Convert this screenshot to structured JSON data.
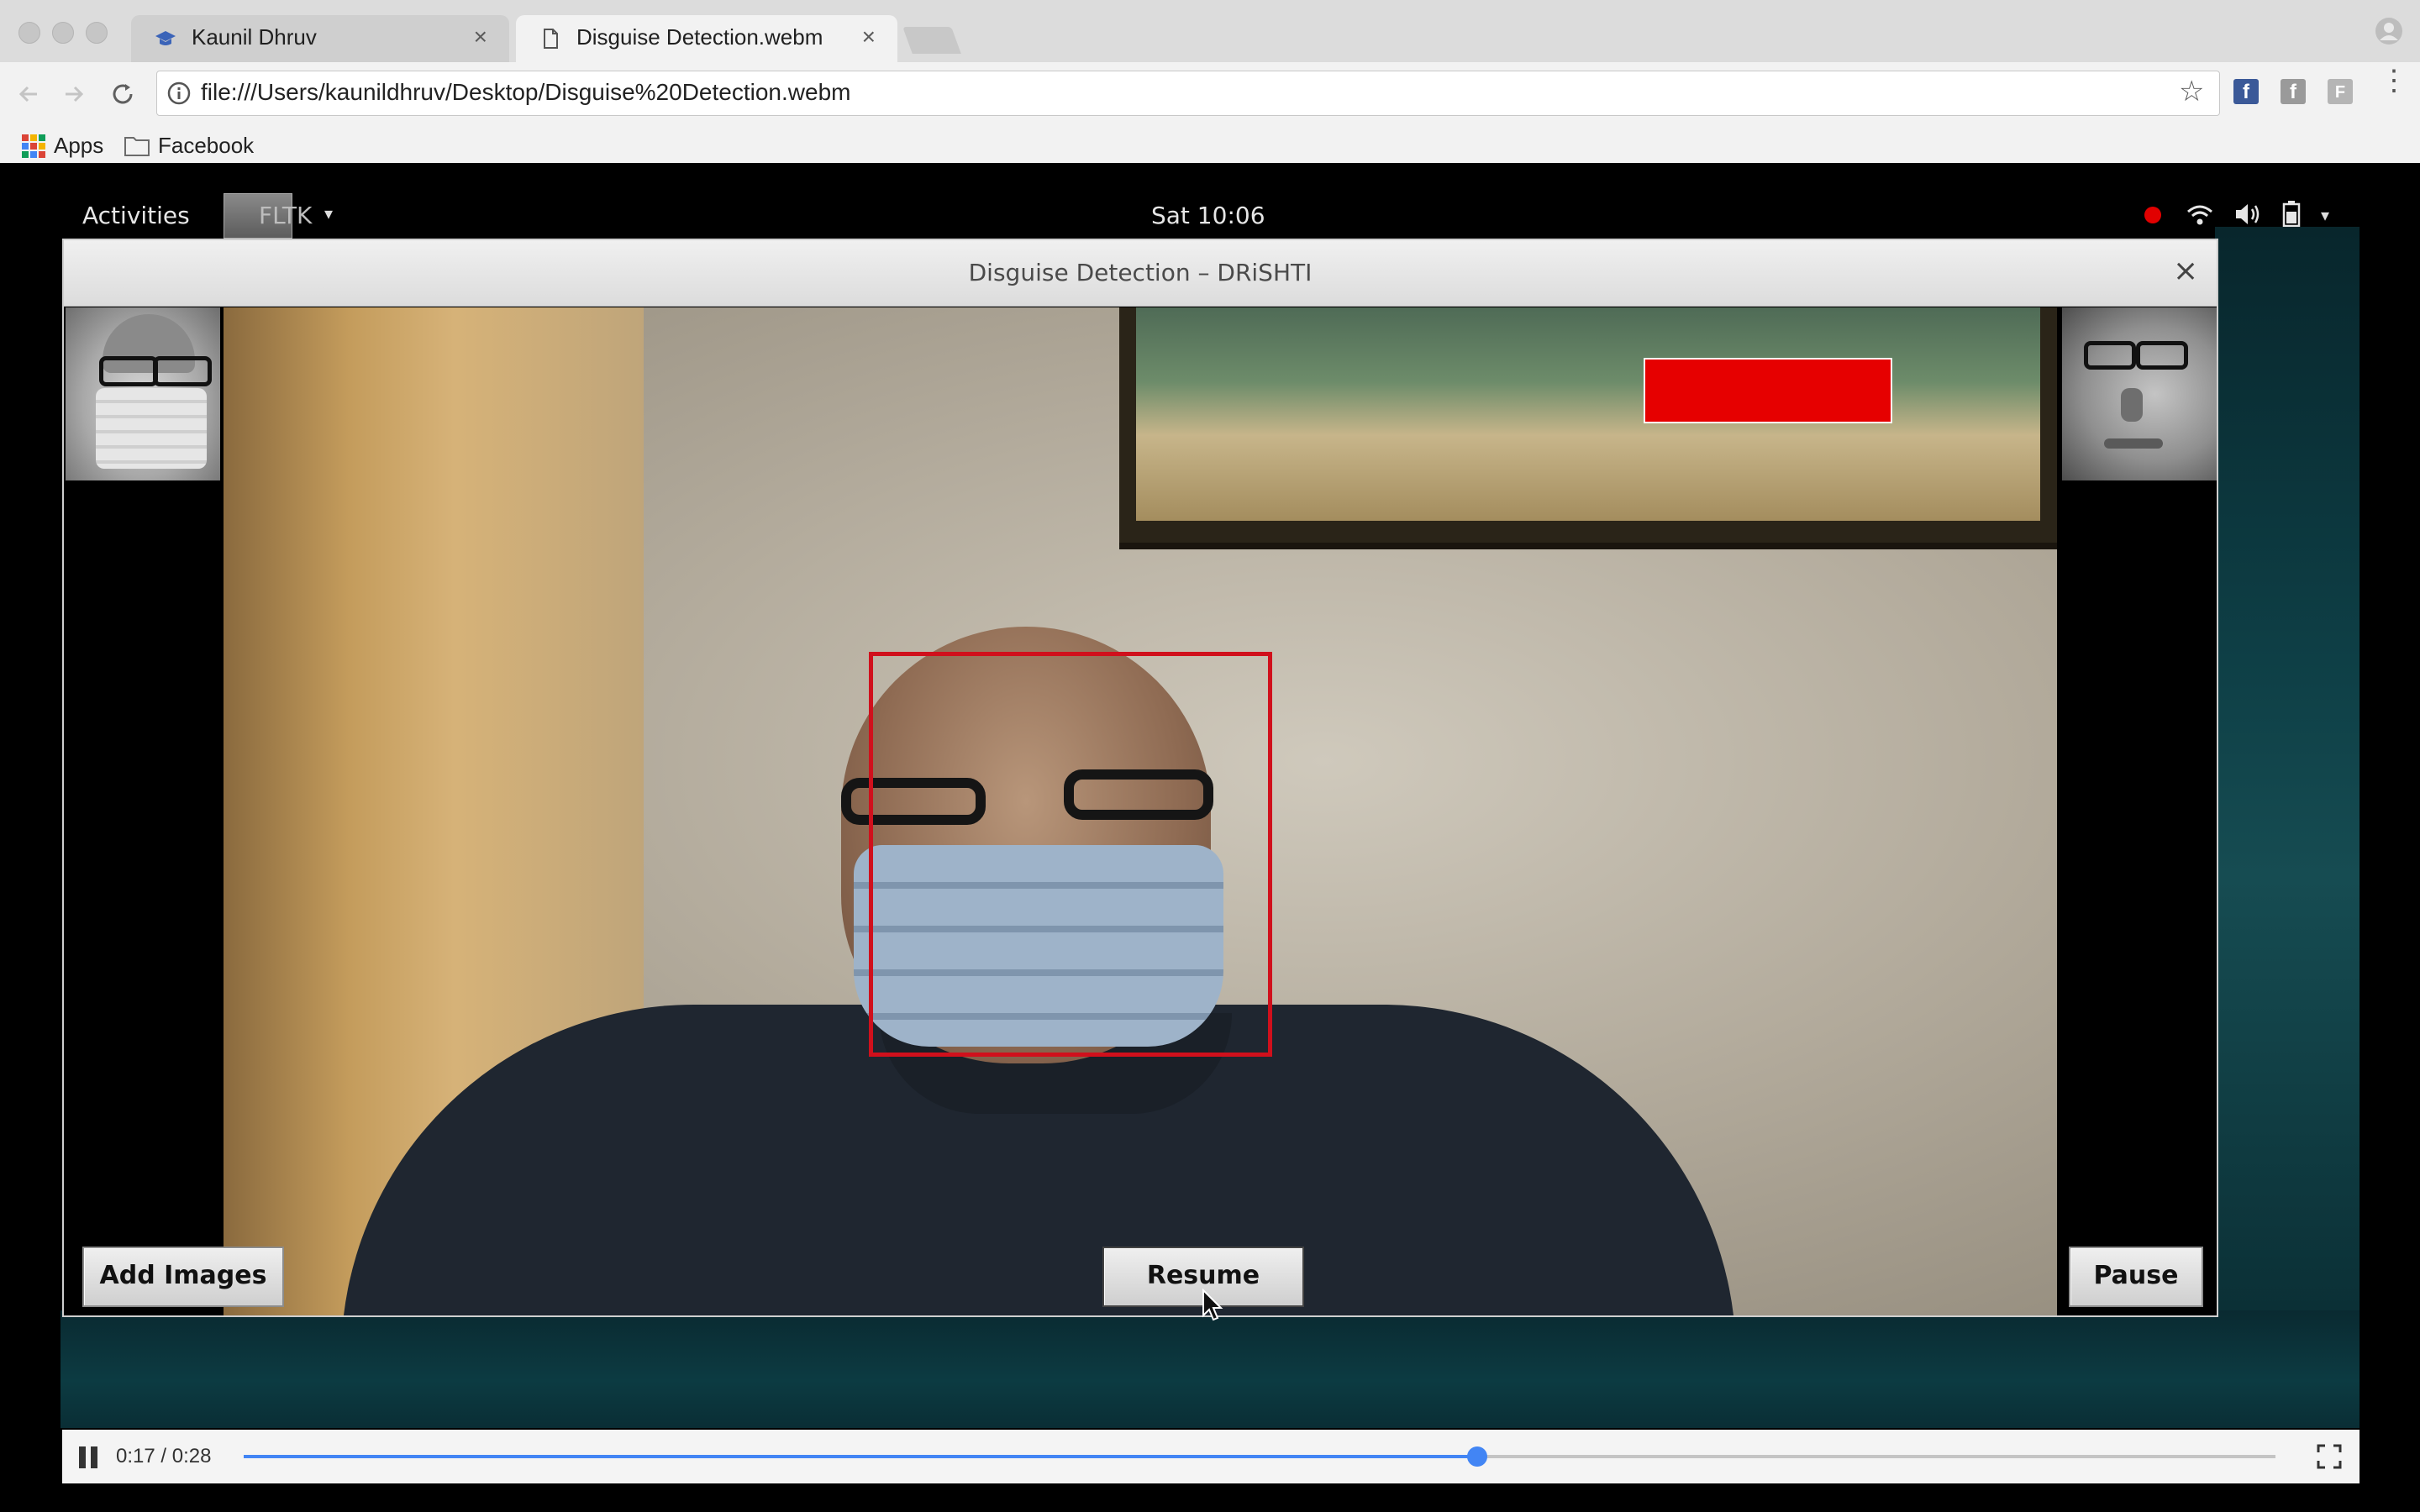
{
  "browser": {
    "tabs": [
      {
        "title": "Kaunil Dhruv",
        "icon": "graduation-cap-icon",
        "active": false
      },
      {
        "title": "Disguise Detection.webm",
        "icon": "document-icon",
        "active": true
      }
    ],
    "url": "file:///Users/kaunildhruv/Desktop/Disguise%20Detection.webm",
    "bookmarks": [
      {
        "label": "Apps",
        "icon": "apps-grid-icon"
      },
      {
        "label": "Facebook",
        "icon": "folder-icon"
      }
    ]
  },
  "desktop": {
    "activities": "Activities",
    "app_menu": "FLTK",
    "clock": "Sat 10:06"
  },
  "app": {
    "title": "Disguise Detection – DRiSHTI",
    "close": "×",
    "buttons": {
      "add_images": "Add Images",
      "resume": "Resume",
      "pause": "Pause"
    },
    "alert_color": "#e60000",
    "detection_box_color": "#d0101c"
  },
  "player": {
    "time": "0:17 / 0:28",
    "progress": 0.607,
    "accent": "#4285f4"
  }
}
